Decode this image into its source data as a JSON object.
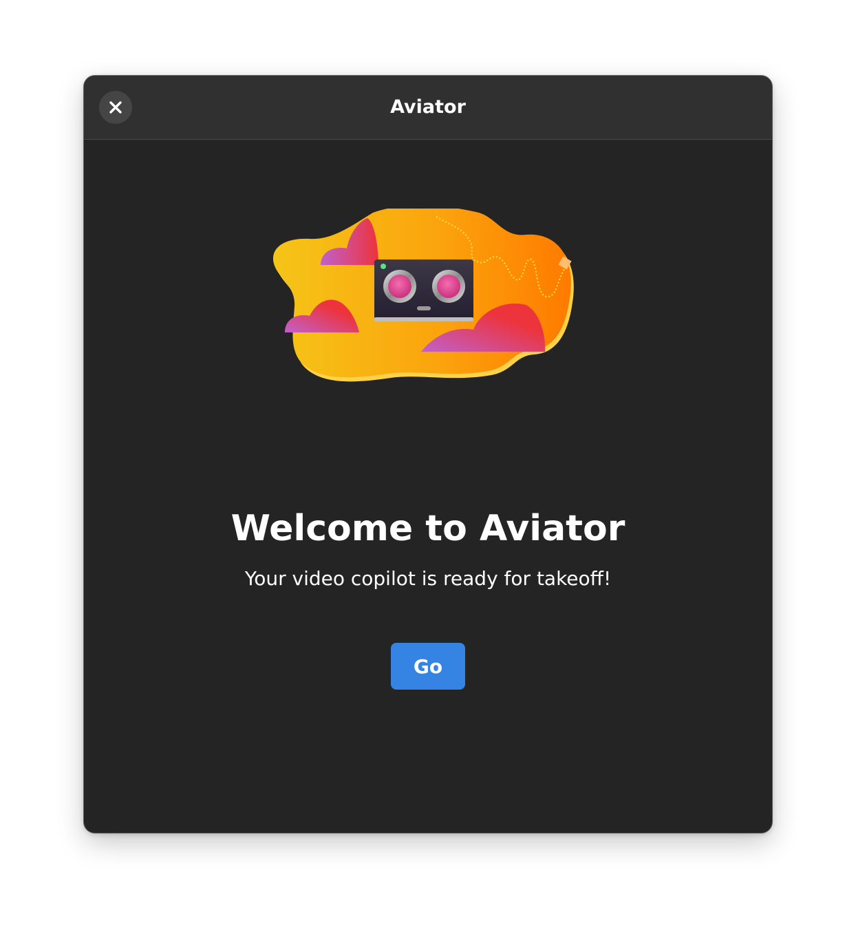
{
  "window": {
    "title": "Aviator",
    "close_icon": "close-icon"
  },
  "welcome": {
    "illustration": "robot-camera-cloud-illustration",
    "title": "Welcome to Aviator",
    "subtitle": "Your video copilot is ready for takeoff!",
    "go_label": "Go"
  },
  "colors": {
    "window_bg": "#242424",
    "headerbar_bg": "#303030",
    "accent": "#3584e4",
    "text": "#ffffff"
  }
}
